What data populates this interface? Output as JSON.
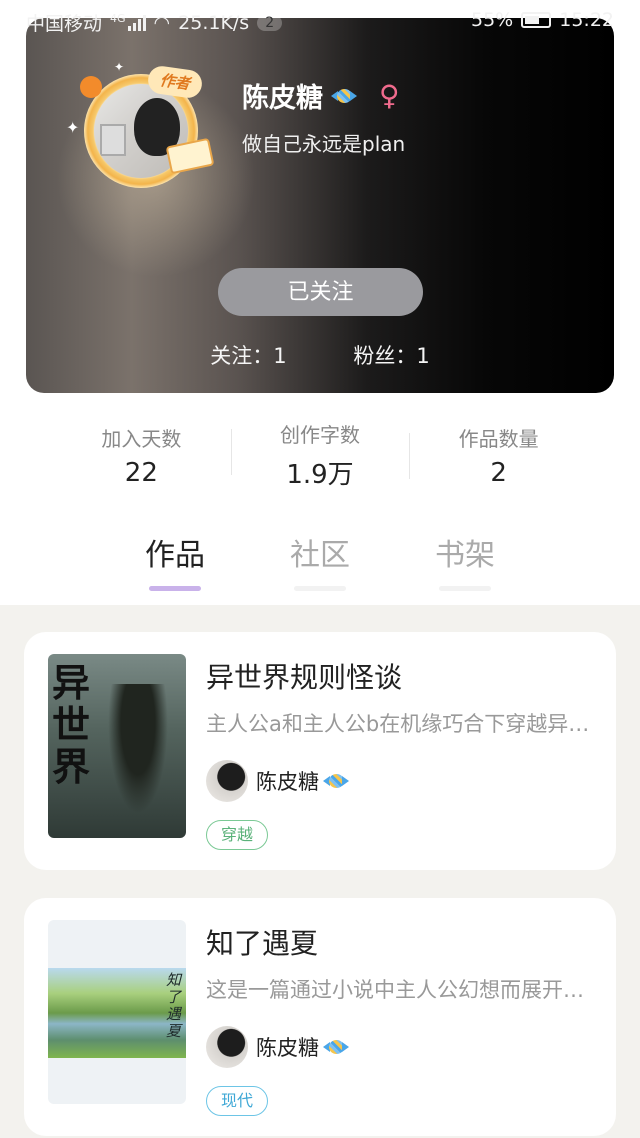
{
  "status_bar": {
    "carrier": "中国移动",
    "network_type": "4G",
    "speed": "25.1K/s",
    "notification_count": "2",
    "battery": "55%",
    "time": "15:22"
  },
  "profile": {
    "author_badge": "作者",
    "name": "陈皮糖",
    "gender_symbol": "♀",
    "motto": "做自己永远是plan",
    "follow_button_label": "已关注",
    "following_label": "关注：1",
    "fans_label": "粉丝：1"
  },
  "stats": [
    {
      "label": "加入天数",
      "value": "22"
    },
    {
      "label": "创作字数",
      "value": "1.9万"
    },
    {
      "label": "作品数量",
      "value": "2"
    }
  ],
  "tabs": [
    {
      "label": "作品",
      "active": true
    },
    {
      "label": "社区",
      "active": false
    },
    {
      "label": "书架",
      "active": false
    }
  ],
  "works": [
    {
      "title": "异世界规则怪谈",
      "description": "主人公a和主人公b在机缘巧合下穿越异世界",
      "author": "陈皮糖",
      "genre": "穿越",
      "cover_text": "异世界"
    },
    {
      "title": "知了遇夏",
      "description": "这是一篇通过小说中主人公幻想而展开的故事",
      "author": "陈皮糖",
      "genre": "现代",
      "cover_text": "知了遇夏"
    }
  ],
  "colors": {
    "tab_active_underline": "#c9b2ea",
    "gender_pink": "#f06b8d",
    "tag_green": "#5bb27a",
    "tag_blue": "#3fa8d6",
    "follow_button_bg": "#9a9a9e"
  }
}
